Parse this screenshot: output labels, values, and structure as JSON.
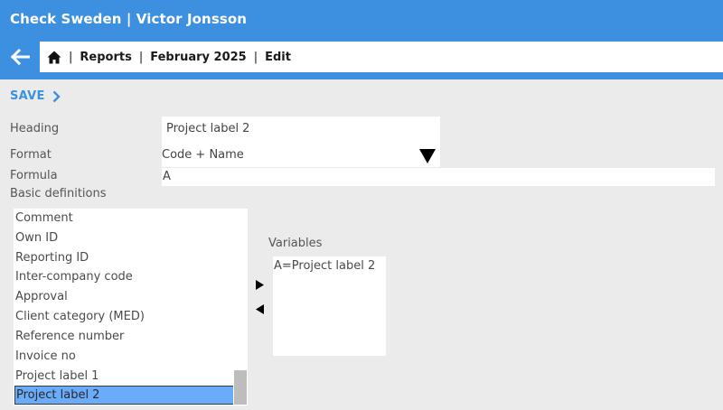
{
  "header": {
    "app_title": "Check Sweden | Victor Jonsson",
    "breadcrumb": [
      "Reports",
      "February 2025",
      "Edit"
    ]
  },
  "toolbar": {
    "save_label": "SAVE"
  },
  "form": {
    "heading_label": "Heading",
    "heading_value": "Project label 2",
    "format_label": "Format",
    "format_value": "Code + Name",
    "formula_label": "Formula",
    "formula_value": "A",
    "basic_definitions_label": "Basic definitions",
    "basic_definitions": [
      "Comment",
      "Own ID",
      "Reporting ID",
      "Inter-company code",
      "Approval",
      "Client category (MED)",
      "Reference number",
      "Invoice no",
      "Project label 1",
      "Project label 2"
    ],
    "selected_definition": "Project label 2",
    "variables_label": "Variables",
    "variables": [
      "A=Project label 2"
    ]
  },
  "icons": {
    "back": "arrow-left-icon",
    "home": "home-icon",
    "save": "chevron-right-icon",
    "format_dropdown": "triangle-down-icon",
    "add": "triangle-right-icon",
    "remove": "triangle-left-icon"
  },
  "colors": {
    "accent": "#3d8fe0",
    "selection": "#6aabfa",
    "background": "#ebebeb"
  }
}
